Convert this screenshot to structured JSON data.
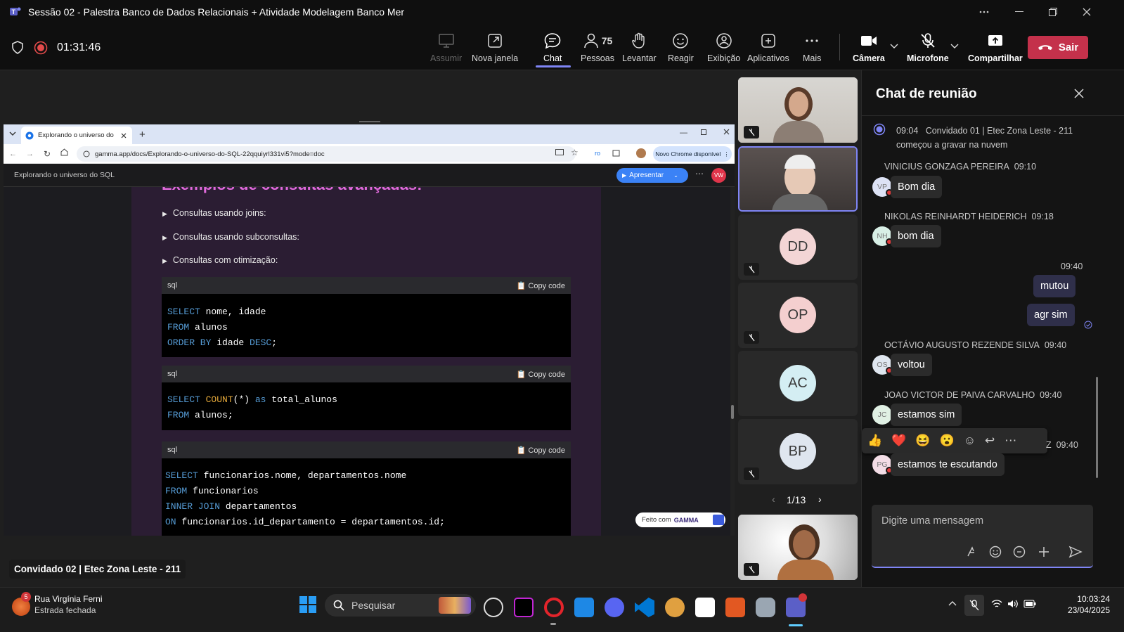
{
  "window": {
    "title": "Sessão 02 - Palestra Banco de Dados Relacionais + Atividade Modelagem Banco Mer"
  },
  "toolbar": {
    "timer": "01:31:46",
    "assumir": "Assumir",
    "nova_janela": "Nova janela",
    "chat": "Chat",
    "pessoas": "Pessoas",
    "pessoas_count": "75",
    "levantar": "Levantar",
    "reagir": "Reagir",
    "exibicao": "Exibição",
    "aplicativos": "Aplicativos",
    "mais": "Mais",
    "camera": "Câmera",
    "microfone": "Microfone",
    "compartilhar": "Compartilhar",
    "sair": "Sair"
  },
  "browser": {
    "tab_title": "Explorando o universo do SQL",
    "url": "gamma.app/docs/Explorando-o-universo-do-SQL-22qquiyrl331vi5?mode=doc",
    "ext_ro": "ro",
    "chrome_update": "Novo Chrome disponível",
    "doc_title": "Explorando o universo do SQL",
    "apresentar": "Apresentar",
    "user_initials": "VW",
    "made_with": "Feito com",
    "gamma_brand": "GAMMA"
  },
  "doc": {
    "heading": "Exemplos de consultas avançadas:",
    "toggles": [
      "Consultas usando joins:",
      "Consultas usando subconsultas:",
      "Consultas com otimização:"
    ],
    "lang": "sql",
    "copy": "Copy code",
    "block1": [
      {
        "kw": "SELECT",
        "rest": " nome, idade"
      },
      {
        "kw": "FROM",
        "rest": " alunos"
      },
      {
        "kw": "ORDER BY",
        "rest": " idade ",
        "kw2": "DESC",
        "rest2": ";"
      }
    ],
    "block2": [
      {
        "kw": "SELECT",
        "fn": "COUNT",
        "mid": "(*) ",
        "kw2": "as",
        "rest": " total_alunos"
      },
      {
        "kw": "FROM",
        "rest": " alunos;"
      }
    ],
    "block3": [
      {
        "kw": "SELECT",
        "rest": " funcionarios.nome, departamentos.nome"
      },
      {
        "kw": "FROM",
        "rest": " funcionarios"
      },
      {
        "kw": "INNER JOIN",
        "rest": " departamentos"
      },
      {
        "kw": "ON",
        "rest": " funcionarios.id_departamento = departamentos.id;"
      }
    ]
  },
  "presenter": "Convidado 02 | Etec Zona Leste - 211",
  "participants": {
    "tiles": [
      "DD",
      "OP",
      "AC",
      "BP"
    ],
    "tile_colors": [
      "#f3d5d5",
      "#f4cfcf",
      "#d4eef3",
      "#dfe6ef"
    ],
    "page": "1/13"
  },
  "chat": {
    "title": "Chat de reunião",
    "recording": {
      "time": "09:04",
      "text": "Convidado 01 | Etec Zona Leste - 211",
      "text2": "começou a gravar na nuvem"
    },
    "messages": [
      {
        "name": "VINICIUS GONZAGA PEREIRA",
        "time": "09:10",
        "initials": "VP",
        "text": "Bom dia"
      },
      {
        "name": "NIKOLAS REINHARDT HEIDERICH",
        "time": "09:18",
        "initials": "NH",
        "text": "bom dia"
      },
      {
        "name": "OCTÁVIO AUGUSTO REZENDE SILVA",
        "time": "09:40",
        "initials": "OS",
        "text": "voltou"
      },
      {
        "name": "JOAO VICTOR DE PAIVA CARVALHO",
        "time": "09:40",
        "initials": "JC",
        "text": "estamos sim"
      },
      {
        "name": "Z",
        "time": "09:40",
        "initials": "PG",
        "text": "estamos te escutando"
      }
    ],
    "own_time": "09:40",
    "own_messages": [
      "mutou",
      "agr sim"
    ],
    "input_placeholder": "Digite uma mensagem"
  },
  "taskbar": {
    "weather_badge": "5",
    "weather_title": "Rua Virgínia Ferni",
    "weather_sub": "Estrada fechada",
    "search": "Pesquisar",
    "time": "10:03:24",
    "date": "23/04/2025"
  }
}
